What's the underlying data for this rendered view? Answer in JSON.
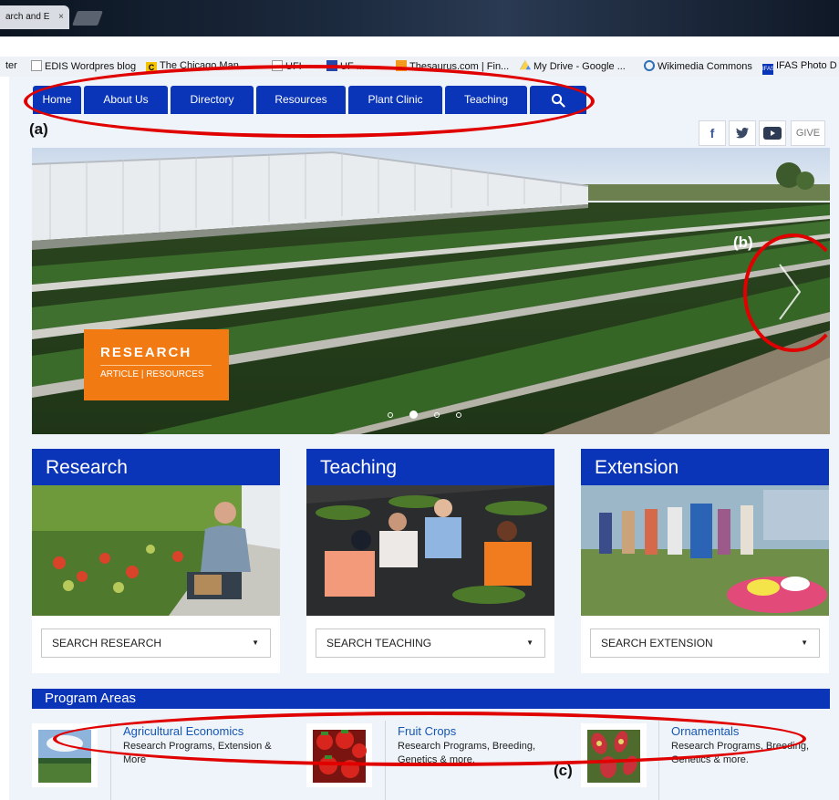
{
  "browser": {
    "tab_title": "arch and E",
    "tab_close": "×",
    "bookmarks": [
      {
        "label": "ter",
        "icon": "page-icon"
      },
      {
        "label": "EDIS Wordpres blog",
        "icon": "page-icon"
      },
      {
        "label": "The Chicago Man...",
        "icon": "chicago-manual-icon"
      },
      {
        "label": "UFI",
        "icon": "page-icon"
      },
      {
        "label": "UF ...",
        "icon": "uf-icon"
      },
      {
        "label": "Thesaurus.com | Fin...",
        "icon": "thesaurus-icon"
      },
      {
        "label": "My Drive - Google ...",
        "icon": "google-drive-icon"
      },
      {
        "label": "Wikimedia Commons",
        "icon": "wikimedia-icon"
      },
      {
        "label": "IFAS Photo D",
        "icon": "ifas-icon"
      }
    ]
  },
  "nav": {
    "items": [
      "Home",
      "About Us",
      "Directory",
      "Resources",
      "Plant Clinic",
      "Teaching"
    ],
    "search_icon": "search-icon"
  },
  "annotations": {
    "a": "(a)",
    "b": "(b)",
    "c": "(c)"
  },
  "social": {
    "facebook": "f",
    "twitter": "twitter-icon",
    "youtube": "youtube-icon",
    "give": "GIVE"
  },
  "hero": {
    "title": "RESEARCH",
    "subtitle": "ARTICLE | RESOURCES",
    "slides": 4,
    "active_slide": 2
  },
  "cards": [
    {
      "title": "Research",
      "select": "SEARCH RESEARCH"
    },
    {
      "title": "Teaching",
      "select": "SEARCH TEACHING"
    },
    {
      "title": "Extension",
      "select": "SEARCH EXTENSION"
    }
  ],
  "program_areas": {
    "heading": "Program Areas",
    "items": [
      {
        "title": "Agricultural Economics",
        "line1": "Research Programs, Extension &",
        "line2": "More"
      },
      {
        "title": "Fruit Crops",
        "line1": "Research Programs, Breeding,",
        "line2": "Genetics & more."
      },
      {
        "title": "Ornamentals",
        "line1": "Research Programs, Breeding,",
        "line2": "Genetics & more."
      }
    ]
  },
  "colors": {
    "nav_blue": "#0a35b8",
    "accent_orange": "#f27a12",
    "annotation_red": "#e00000"
  }
}
